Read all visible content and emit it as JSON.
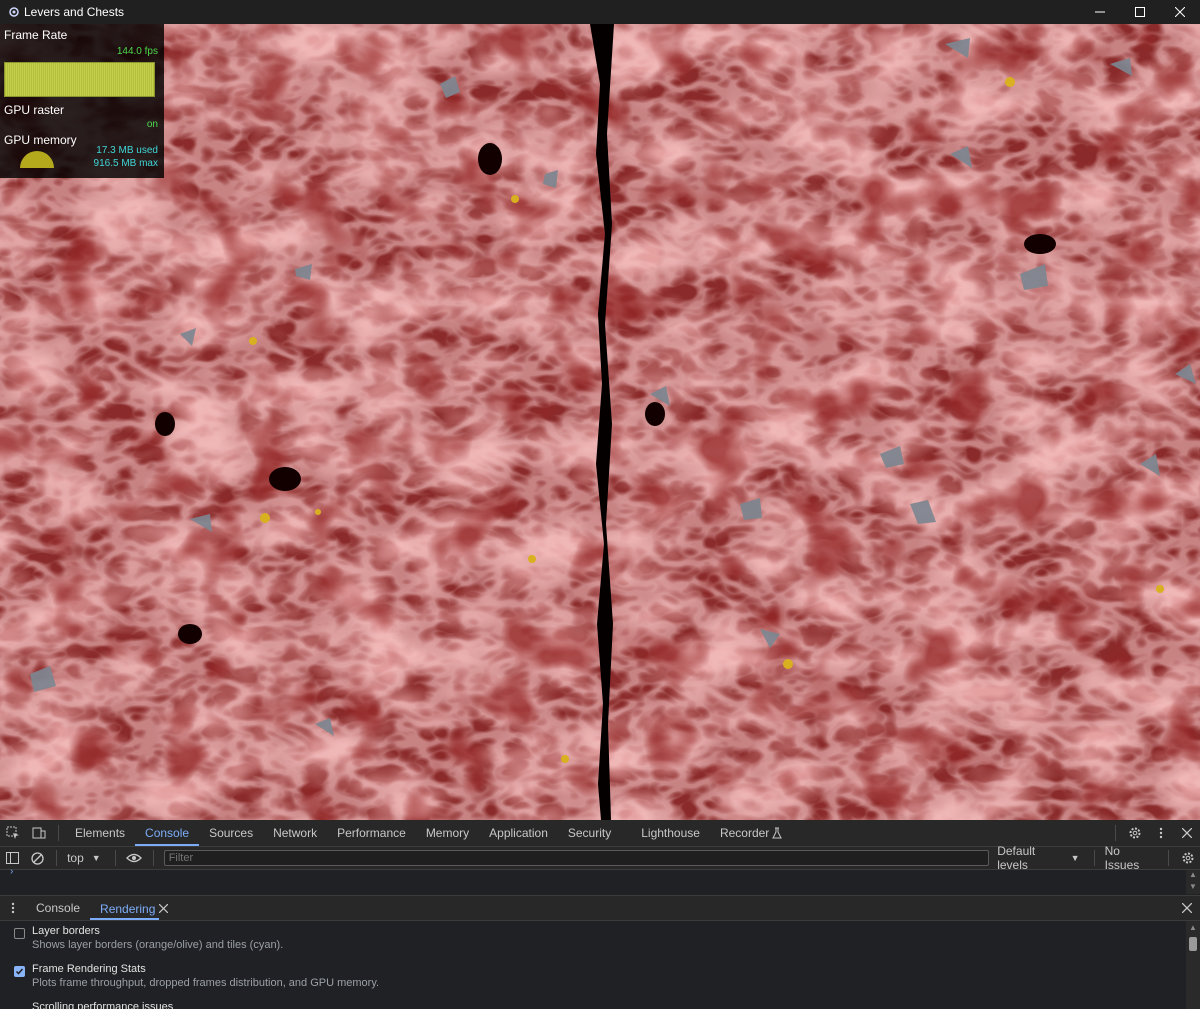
{
  "window": {
    "title": "Levers and Chests"
  },
  "hud": {
    "frame_rate_label": "Frame Rate",
    "fps_value": "144.0 fps",
    "gpu_raster_label": "GPU raster",
    "gpu_raster_value": "on",
    "gpu_memory_label": "GPU memory",
    "memory_used": "17.3 MB used",
    "memory_max": "916.5 MB max"
  },
  "devtools": {
    "tabs": [
      "Elements",
      "Console",
      "Sources",
      "Network",
      "Performance",
      "Memory",
      "Application",
      "Security",
      "Lighthouse",
      "Recorder"
    ],
    "active_tab": "Console",
    "console_bar": {
      "context": "top",
      "filter_placeholder": "Filter",
      "levels": "Default levels",
      "issues": "No Issues"
    },
    "drawer_tabs": {
      "console": "Console",
      "rendering": "Rendering"
    },
    "rendering_options": [
      {
        "title": "Layer borders",
        "desc": "Shows layer borders (orange/olive) and tiles (cyan).",
        "checked": false
      },
      {
        "title": "Frame Rendering Stats",
        "desc": "Plots frame throughput, dropped frames distribution, and GPU memory.",
        "checked": true
      },
      {
        "title": "Scrolling performance issues",
        "desc": "",
        "checked": false
      }
    ]
  },
  "colors": {
    "accent": "#7cacf8",
    "fps_green": "#4cd94c",
    "memory_cyan": "#3fd7d7"
  }
}
